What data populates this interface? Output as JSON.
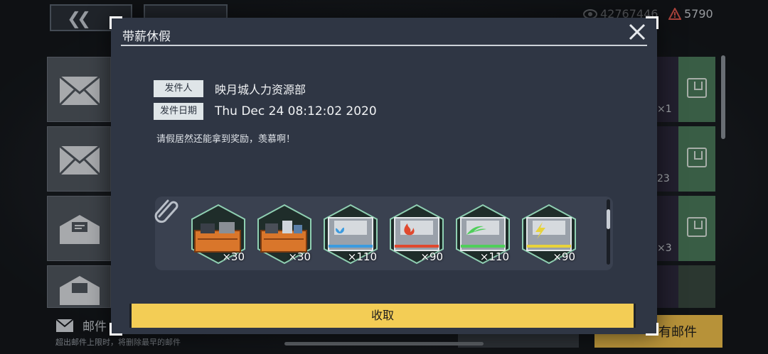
{
  "background": {
    "currency": [
      {
        "icon": "eye-icon",
        "value": "42767446"
      },
      {
        "icon": "warning-icon",
        "value": "5790"
      }
    ],
    "side_counts": [
      "×1",
      "23",
      "×3"
    ],
    "bottom": {
      "mail_label": "邮件",
      "limit_note": "超出邮件上限时，将删除最早的邮件",
      "claim_all_label": "有邮件"
    }
  },
  "dialog": {
    "title": "带薪休假",
    "sender_label": "发件人",
    "sender": "映月城人力资源部",
    "date_label": "发件日期",
    "date": "Thu Dec 24 08:12:02 2020",
    "body": "请假居然还能拿到奖励，羡慕啊！",
    "attachments": [
      {
        "icon": "orange-supply-crate-icon",
        "quantity": "×30",
        "color": "#d9762b"
      },
      {
        "icon": "orange-supply-crate-icon",
        "quantity": "×30",
        "color": "#d9762b"
      },
      {
        "icon": "water-kit-icon",
        "quantity": "×110",
        "color": "#3b9be0"
      },
      {
        "icon": "fire-kit-icon",
        "quantity": "×90",
        "color": "#e0492e"
      },
      {
        "icon": "wind-kit-icon",
        "quantity": "×110",
        "color": "#4fcf5a"
      },
      {
        "icon": "lightning-kit-icon",
        "quantity": "×90",
        "color": "#e8d33a"
      }
    ],
    "claim_label": "收取"
  }
}
